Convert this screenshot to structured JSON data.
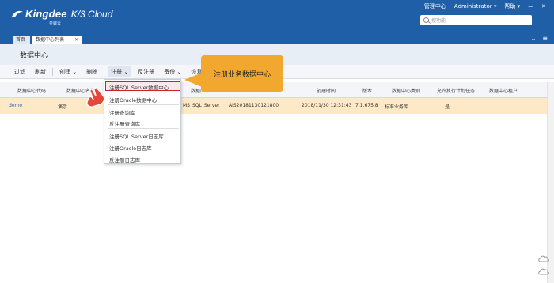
{
  "header": {
    "brand": "Kingdee",
    "product": "K/3 Cloud",
    "brand_cn": "金蝶云",
    "links": [
      "管理中心",
      "Administrator",
      "帮助"
    ],
    "search_placeholder": "搜功能"
  },
  "tabs": [
    {
      "label": "首页"
    },
    {
      "label": "数据中心列表"
    }
  ],
  "page": {
    "title": "数据中心"
  },
  "toolbar": {
    "items": [
      "过滤",
      "刷新",
      "创建",
      "删除",
      "注册",
      "反注册",
      "备份",
      "恢复"
    ]
  },
  "grid": {
    "columns": [
      "数据中心代码",
      "数据中心名称",
      "数据库",
      "创建时间",
      "版本",
      "数据中心类别",
      "允许执行计划任务",
      "数据中心租户"
    ],
    "rows": [
      {
        "code": "demo",
        "name": "演示",
        "db_type": "MS_SQL_Server",
        "db": "AIS20181130121800",
        "created": "2018/11/30 12:31:43",
        "version": "7.1.675.8",
        "category": "标准业务库",
        "schedule": "是",
        "tenant": ""
      }
    ]
  },
  "menu": {
    "items": [
      "注册SQL Server数据中心",
      "注册Oracle数据中心",
      "注册查询库",
      "反注册查询库",
      "注册SQL Server日志库",
      "注册Oracle日志库",
      "反注册日志库"
    ]
  },
  "callout": {
    "text": "注册业务数据中心"
  },
  "colors": {
    "header": "#1f5fa8",
    "accent": "#f2a82e",
    "highlight_border": "#c7242b",
    "row_selected": "#fde9c6"
  }
}
